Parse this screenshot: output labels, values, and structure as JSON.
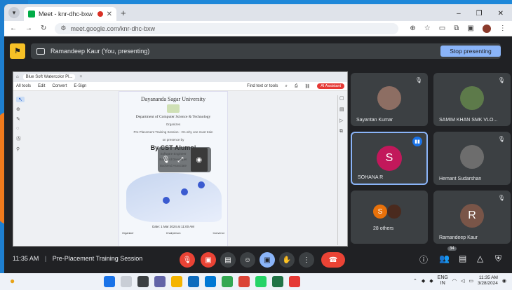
{
  "browser": {
    "tab_title": "Meet - knr-dhc-bxw",
    "url": "meet.google.com/knr-dhc-bxw"
  },
  "presenting": {
    "label": "Ramandeep Kaur (You, presenting)",
    "stop_button": "Stop presenting"
  },
  "shared_screen": {
    "tab": "Blue Soft Watercolor Pl...",
    "menu": [
      "All tools",
      "Edit",
      "Convert",
      "E-Sign"
    ],
    "find_text": "Find text or tools",
    "ai_button": "AI Assistant",
    "poster": {
      "university": "Dayananda Sagar University",
      "department": "Department of Computer Science & Technology",
      "organizes": "Organizes",
      "session": "Pre Placement Training Session - On why one must train",
      "on_presence": "on presence by",
      "by": "By CST Alumni",
      "line1": "Software Engineer",
      "line2": "Backend Developer",
      "line3": "Backend Associate",
      "date": "Date: 1 Mar 2024 at 11:00 AM",
      "signatories": [
        "Organizer",
        "Chairperson",
        "Convenor"
      ]
    }
  },
  "participants": [
    {
      "name": "Sayantan Kumar",
      "avatar_type": "photo"
    },
    {
      "name": "SAMIM KHAN SMK VLO...",
      "avatar_type": "photo"
    },
    {
      "name": "SOHANA R",
      "initial": "S",
      "color": "#c2185b",
      "speaking": true
    },
    {
      "name": "Hemant Sudarshan",
      "avatar_type": "photo"
    },
    {
      "name": "28 others",
      "initial": "S",
      "color": "#e8710a"
    },
    {
      "name": "Ramandeep Kaur",
      "initial": "R",
      "color": "#795548"
    }
  ],
  "meeting": {
    "time": "11:35 AM",
    "title": "Pre-Placement Training Session",
    "participant_count": "34"
  },
  "taskbar": {
    "lang_top": "ENG",
    "lang_bottom": "IN",
    "time": "11:35 AM",
    "date": "3/28/2024"
  },
  "colors": {
    "meet_bg": "#202124",
    "tile_bg": "#3c4043",
    "end_call": "#ea4335",
    "accent": "#8ab4f8"
  }
}
